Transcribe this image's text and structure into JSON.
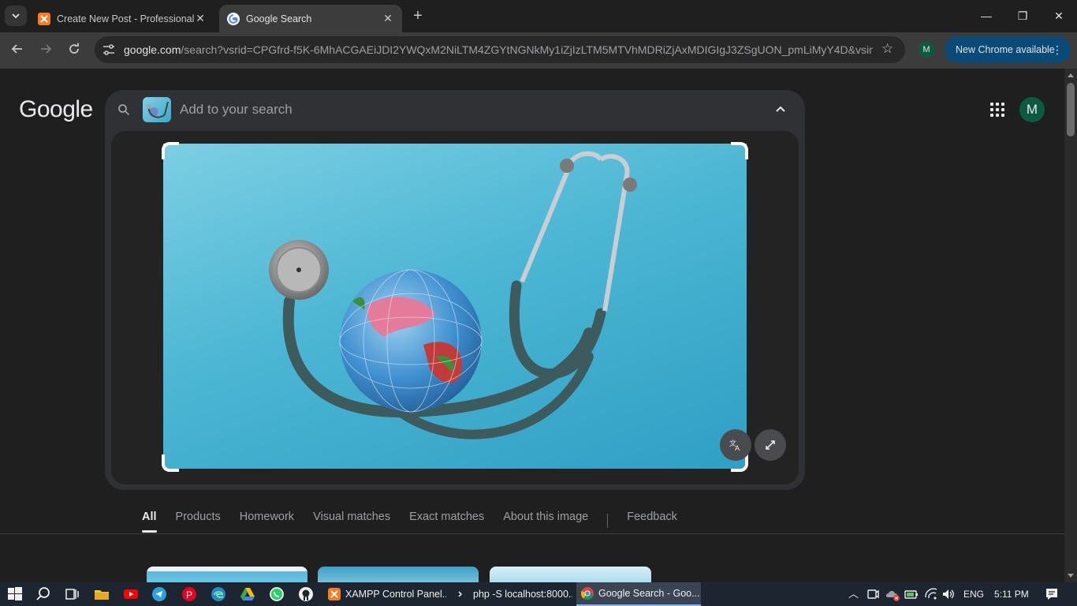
{
  "browser": {
    "tabs": [
      {
        "title": "Create New Post - Professional",
        "icon": "xampp-icon",
        "active": false
      },
      {
        "title": "Google Search",
        "icon": "google-icon",
        "active": true
      }
    ],
    "url_host": "google.com",
    "url_path": "/search?vsrid=CPGfrd-f5K-6MhACGAEiJDI2YWQxM2NiLTM4ZGYtNGNkMy1iZjIzLTM5MTVhMDRiZjAxMDIGIgJ3ZSgUON_pmLiMyY4D&vsint=...",
    "profile_initial": "M",
    "update_label": "New Chrome available"
  },
  "page": {
    "logo": "Google",
    "avatar_initial": "M",
    "search_placeholder": "Add to your search",
    "filters": [
      "All",
      "Products",
      "Homework",
      "Visual matches",
      "Exact matches",
      "About this image",
      "Feedback"
    ],
    "active_filter": "All"
  },
  "taskbar": {
    "apps": [
      {
        "label": "XAMPP Control Panel...",
        "icon": "xampp-icon"
      },
      {
        "label": "php -S localhost:8000...",
        "icon": "terminal-icon"
      },
      {
        "label": "Google Search - Goo...",
        "icon": "chrome-icon"
      }
    ],
    "language": "ENG",
    "time": "5:11 PM"
  },
  "colors": {
    "accent": "#8ab4f8",
    "update_chip": "#0a4a78",
    "avatar": "#0b5a41"
  }
}
